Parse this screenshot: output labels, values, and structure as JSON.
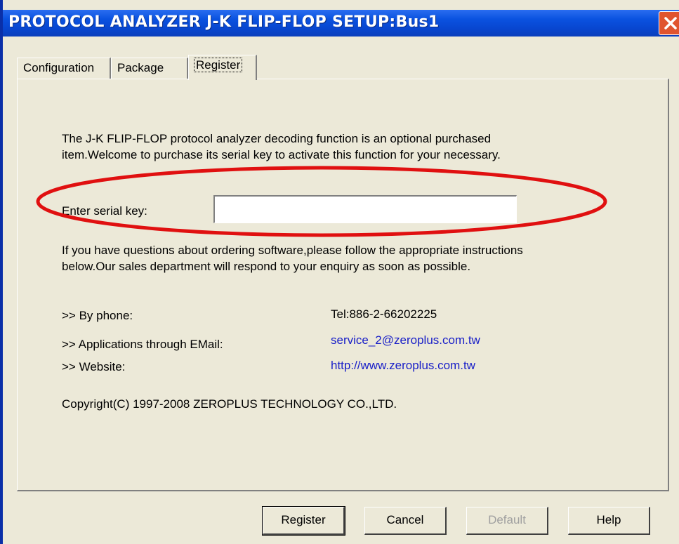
{
  "window": {
    "title": "PROTOCOL ANALYZER J-K FLIP-FLOP SETUP:Bus1"
  },
  "tabs": [
    {
      "label": "Configuration"
    },
    {
      "label": "Package"
    },
    {
      "label": "Register",
      "active": true
    }
  ],
  "register": {
    "intro_line1": "The J-K FLIP-FLOP protocol analyzer decoding function is an optional purchased",
    "intro_line2": "item.Welcome to purchase its serial key to activate this function for your necessary.",
    "serial_label": "Enter serial key:",
    "serial_value": "",
    "questions_line1": "If you  have questions about ordering software,please follow the appropriate instructions",
    "questions_line2": "below.Our sales department will respond to your enquiry as soon as possible.",
    "contacts": [
      {
        "label": ">> By phone:",
        "value": "Tel:886-2-66202225"
      },
      {
        "label": ">> Applications through EMail:",
        "value": "service_2@zeroplus.com.tw"
      },
      {
        "label": ">> Website:",
        "value": "http://www.zeroplus.com.tw"
      }
    ],
    "copyright": "Copyright(C) 1997-2008 ZEROPLUS TECHNOLOGY CO.,LTD."
  },
  "buttons": {
    "register": "Register",
    "cancel": "Cancel",
    "default": "Default",
    "help": "Help"
  },
  "colors": {
    "titlebar": "#0a52e0",
    "dialog_bg": "#ece9d8",
    "link": "#1a20c8",
    "highlight_ellipse": "#e01010",
    "close_button": "#e0542f"
  }
}
